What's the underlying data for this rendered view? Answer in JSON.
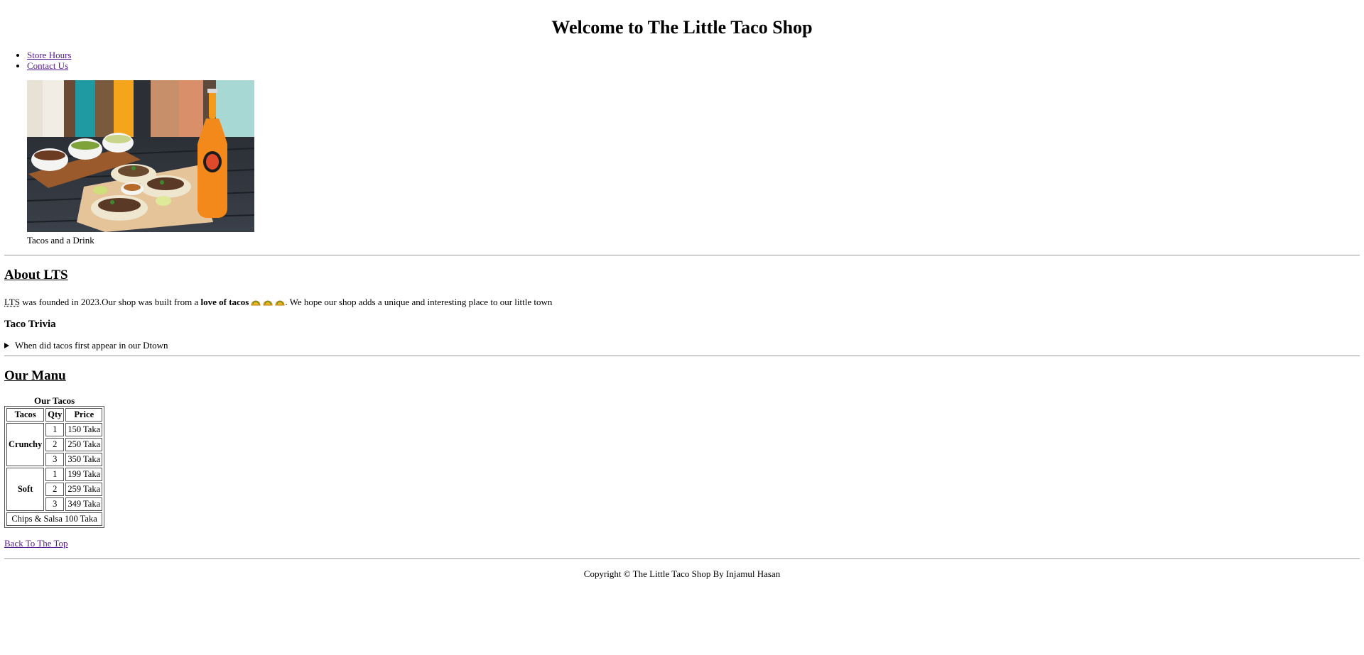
{
  "header": {
    "title": "Welcome to The Little Taco Shop"
  },
  "nav": {
    "items": [
      "Store Hours",
      "Contact Us"
    ]
  },
  "figure": {
    "caption": "Tacos and a Drink"
  },
  "about": {
    "heading": "About LTS",
    "abbr": "LTS",
    "text_before_bold": " was founded in 2023.Our shop was built from a ",
    "bold_text": "love of tacos",
    "text_after": ". We hope our shop adds a unique and interesting place to our little town"
  },
  "trivia": {
    "heading": "Taco Trivia",
    "summary": "When did tacos first appear in our Dtown"
  },
  "menu": {
    "heading": "Our Manu",
    "table": {
      "caption": "Our Tacos",
      "headers": [
        "Tacos",
        "Qty",
        "Price"
      ],
      "crunchy": {
        "label": "Crunchy",
        "rows": [
          [
            "1",
            "150 Taka"
          ],
          [
            "2",
            "250 Taka"
          ],
          [
            "3",
            "350 Taka"
          ]
        ]
      },
      "soft": {
        "label": "Soft",
        "rows": [
          [
            "1",
            "199 Taka"
          ],
          [
            "2",
            "259 Taka"
          ],
          [
            "3",
            "349 Taka"
          ]
        ]
      },
      "chips": {
        "label": "Chips & Salsa",
        "price": "100 Taka"
      }
    }
  },
  "back_to_top": "Back To The Top",
  "footer": {
    "copyright": "Copyright © The Little Taco Shop By Injamul Hasan"
  },
  "colors": {
    "link_visited": "#551a8b",
    "rule": "#9a9a9a"
  }
}
